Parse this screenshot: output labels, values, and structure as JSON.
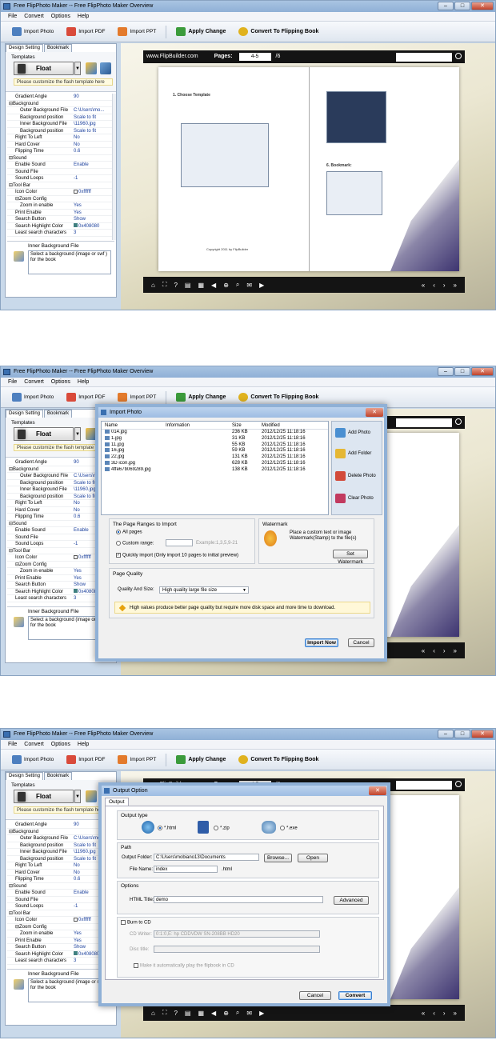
{
  "window": {
    "title": "Free FlipPhoto Maker -- Free FlipPhoto Maker Overview"
  },
  "menu": [
    "File",
    "Convert",
    "Options",
    "Help"
  ],
  "toolbar": {
    "import_photo": "Import Photo",
    "import_pdf": "Import PDF",
    "import_ppt": "Import PPT",
    "apply_change": "Apply Change",
    "convert": "Convert To Flipping Book"
  },
  "panel": {
    "tab_design": "Design Setting",
    "tab_bookmark": "Bookmark",
    "templates_label": "Templates",
    "float_label": "Float",
    "customize": "Please customize the flash template here",
    "props": [
      {
        "k": "Gradient Angle",
        "v": "90",
        "lvl": "i1"
      },
      {
        "k": "⊟Background",
        "v": "",
        "lvl": "i0"
      },
      {
        "k": "Outer Background File",
        "v": "C:\\Users\\mo...",
        "lvl": "i2"
      },
      {
        "k": "Background position",
        "v": "Scale to fit",
        "lvl": "i2"
      },
      {
        "k": "Inner Background File",
        "v": "\\11960.jpg",
        "lvl": "i2"
      },
      {
        "k": "Background position",
        "v": "Scale to fit",
        "lvl": "i2"
      },
      {
        "k": "Right To Left",
        "v": "No",
        "lvl": "i1"
      },
      {
        "k": "Hard Cover",
        "v": "No",
        "lvl": "i1"
      },
      {
        "k": "Flipping Time",
        "v": "0.6",
        "lvl": "i1"
      },
      {
        "k": "⊟Sound",
        "v": "",
        "lvl": "i0"
      },
      {
        "k": "Enable Sound",
        "v": "Enable",
        "lvl": "i1"
      },
      {
        "k": "Sound File",
        "v": "",
        "lvl": "i1"
      },
      {
        "k": "Sound Loops",
        "v": "-1",
        "lvl": "i1"
      },
      {
        "k": "⊟Tool Bar",
        "v": "",
        "lvl": "i0"
      },
      {
        "k": "Icon Color",
        "v": "0xffffff",
        "lvl": "i1"
      },
      {
        "k": "⊟Zoom Config",
        "v": "",
        "lvl": "i1"
      },
      {
        "k": "Zoom in enable",
        "v": "Yes",
        "lvl": "i2"
      },
      {
        "k": "Print Enable",
        "v": "Yes",
        "lvl": "i1"
      },
      {
        "k": "Search Button",
        "v": "Show",
        "lvl": "i1"
      },
      {
        "k": "Search Highlight Color",
        "v": "0x408080",
        "lvl": "i1"
      },
      {
        "k": "Least search characters",
        "v": "3",
        "lvl": "i1"
      }
    ],
    "desc_title": "Inner Background File",
    "desc_text": "Select a background (image or swf ) for the book"
  },
  "preview": {
    "site": "www.FlipBuilder.com",
    "pages_label": "Pages:",
    "page_value": "4-5",
    "total": "/6"
  },
  "book": {
    "choose_template": "1. Choose Template",
    "bookmark": "6. Bookmark:",
    "copyright": "Copyright 2011 by FlipBuilder"
  },
  "import_dialog": {
    "title": "Import Photo",
    "cols": [
      "Name",
      "Information",
      "Size",
      "Modified"
    ],
    "files": [
      {
        "n": "014.jpg",
        "s": "236 KB",
        "m": "2012/12/25 11:18:16"
      },
      {
        "n": "1.jpg",
        "s": "31 KB",
        "m": "2012/12/25 11:18:16"
      },
      {
        "n": "11.jpg",
        "s": "55 KB",
        "m": "2012/12/25 11:18:16"
      },
      {
        "n": "16.jpg",
        "s": "59 KB",
        "m": "2012/12/25 11:18:16"
      },
      {
        "n": "22.jpg",
        "s": "131 KB",
        "m": "2012/12/25 11:18:16"
      },
      {
        "n": "3D icon.jpg",
        "s": "628 KB",
        "m": "2012/12/25 11:18:16"
      },
      {
        "n": "4ffe67b069289.jpg",
        "s": "138 KB",
        "m": "2012/12/25 11:18:16"
      }
    ],
    "add_photo": "Add Photo",
    "add_folder": "Add Folder",
    "delete_photo": "Delete Photo",
    "clear_photo": "Clear Photo",
    "range_title": "The Page Ranges to Import",
    "all_pages": "All pages",
    "custom_range": "Custom range:",
    "range_example": "Example:1,3,5,9-21",
    "quick_import": "Quickly import (Only import 10 pages to initial preview)",
    "watermark_title": "Watermark",
    "watermark_text": "Place a custom text or image Watermark(Stamp) to the file(s)",
    "set_watermark": "Set Watermark",
    "quality_title": "Page Quality",
    "quality_label": "Quality And Size:",
    "quality_value": "High quality large file size",
    "warn": "High values produce better page quality but require more disk space and more time to download.",
    "import_now": "Import Now",
    "cancel": "Cancel"
  },
  "output_dialog": {
    "title": "Output Option",
    "tab": "Output",
    "type_title": "Output type",
    "opt_html": "*.html",
    "opt_zip": "*.zip",
    "opt_exe": "*.exe",
    "path_title": "Path",
    "folder_label": "Output Folder:",
    "folder_value": "C:\\Users\\mobiano13\\Documents",
    "browse": "Browse...",
    "open": "Open",
    "file_label": "File Name:",
    "file_value": "index",
    "file_ext": ".html",
    "options_title": "Options",
    "html_title_label": "HTML Title:",
    "html_title_value": "demo",
    "advanced": "Advanced",
    "burn": "Burn to CD",
    "cd_writer_label": "CD Writer:",
    "cd_writer_value": "0:1:0,E: hp      CDDVDW SN-208BB  HD20",
    "disc_title_label": "Disc title:",
    "autoplay": "Make it automatically play the flipbook in CD",
    "cancel": "Cancel",
    "convert": "Convert"
  }
}
